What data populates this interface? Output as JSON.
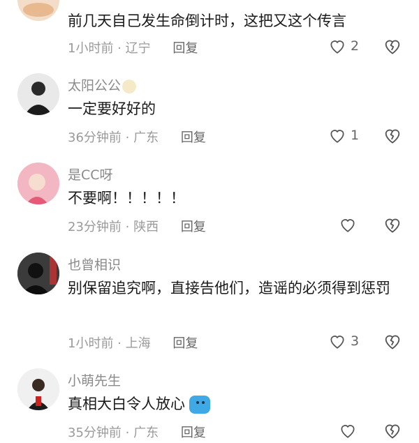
{
  "icons": {
    "like": "heart-outline-icon",
    "dislike": "broken-heart-icon"
  },
  "comments": [
    {
      "username": "",
      "text": "前几天自己发生命倒计时，这把又这个传言",
      "time": "1小时前",
      "location": "辽宁",
      "reply": "回复",
      "likes": "2"
    },
    {
      "username": "太阳公公",
      "text": "一定要好好的",
      "time": "36分钟前",
      "location": "广东",
      "reply": "回复",
      "likes": "1"
    },
    {
      "username": "是CC呀",
      "text": "不要啊！！！！！",
      "time": "23分钟前",
      "location": "陕西",
      "reply": "回复",
      "likes": ""
    },
    {
      "username": "也曾相识",
      "text": "别保留追究啊，直接告他们，造谣的必须得到惩罚",
      "time": "1小时前",
      "location": "上海",
      "reply": "回复",
      "likes": "3"
    },
    {
      "username": "小萌先生",
      "text": "真相大白令人放心",
      "time": "35分钟前",
      "location": "广东",
      "reply": "回复",
      "likes": ""
    }
  ],
  "separator": " · "
}
